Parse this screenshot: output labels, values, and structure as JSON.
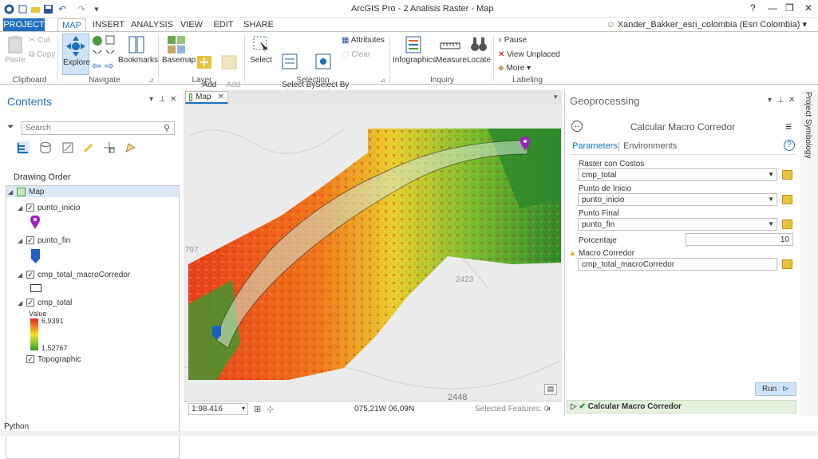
{
  "titlebar": {
    "title": "ArcGIS Pro - 2 Analisis Raster - Map",
    "help": "?",
    "minimize": "—",
    "restore": "❐",
    "close": "✕"
  },
  "tabs": {
    "project": "PROJECT",
    "items": [
      "MAP",
      "INSERT",
      "ANALYSIS",
      "VIEW",
      "EDIT",
      "SHARE"
    ],
    "active": "MAP"
  },
  "user": "Xander_Bakker_esri_colombia (Esri Colombia)",
  "ribbon": {
    "clipboard": {
      "paste": "Paste",
      "cut": "Cut",
      "copy": "Copy",
      "group": "Clipboard"
    },
    "navigate": {
      "explore": "Explore",
      "bookmarks": "Bookmarks",
      "group": "Navigate"
    },
    "layer": {
      "basemap": "Basemap",
      "add_data": "Add\nData",
      "add_preset": "Add\nPreset",
      "group": "Layer"
    },
    "selection": {
      "select": "Select",
      "select_by_attributes": "Select By\nAttributes",
      "select_by_location": "Select By\nLocation",
      "attributes": "Attributes",
      "clear": "Clear",
      "group": "Selection"
    },
    "inquiry": {
      "infographics": "Infographics",
      "measure": "Measure",
      "locate": "Locate",
      "group": "Inquiry"
    },
    "labeling": {
      "pause": "Pause",
      "view_unplaced": "View Unplaced",
      "more": "More",
      "group": "Labeling"
    }
  },
  "contents": {
    "title": "Contents",
    "search_placeholder": "Search",
    "drawing_order": "Drawing Order",
    "layers": {
      "map": "Map",
      "punto_inicio": "punto_inicio",
      "punto_fin": "punto_fin",
      "macro": "cmp_total_macroCorredor",
      "cmp_total": "cmp_total",
      "value_label": "Value",
      "high": "6,9391",
      "low": "1,52767",
      "topographic": "Topographic"
    }
  },
  "map": {
    "tab": "Map",
    "scale": "1:98.416",
    "coords": "075,21W 06,09N",
    "selected": "Selected Features: 0",
    "label_2448": "2448",
    "label_2423": "2423",
    "label_797": "797"
  },
  "geoprocessing": {
    "title": "Geoprocessing",
    "tool": "Calcular Macro Corredor",
    "parameters_tab": "Parameters",
    "environments_tab": "Environments",
    "tab_sep": "|",
    "raster_label": "Raster con Costos",
    "raster_value": "cmp_total",
    "inicio_label": "Punto de Inicio",
    "inicio_value": "punto_inicio",
    "final_label": "Punto Final",
    "final_value": "punto_fin",
    "porcentaje_label": "Porcentaje",
    "porcentaje_value": "10",
    "macro_label": "Macro Corredor",
    "macro_value": "cmp_total_macroCorredor",
    "run": "Run",
    "result": "Calcular Macro Corredor"
  },
  "side_tabs": [
    "Project",
    "Symbology"
  ],
  "python": "Python",
  "colors": {
    "accent": "#1e6fbf",
    "punto_inicio": "#a020c8",
    "punto_fin": "#1e5fbf"
  }
}
